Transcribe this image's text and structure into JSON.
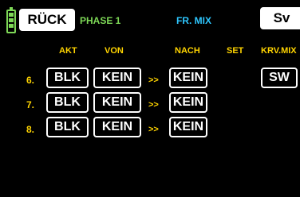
{
  "header": {
    "back_label": "RÜCK",
    "phase_label": "PHASE 1",
    "title": "FR. MIX",
    "sv_label": "Sv"
  },
  "columns": {
    "akt": "AKT",
    "von": "VON",
    "nach": "NACH",
    "set": "SET",
    "krv_mix": "KRV.MIX"
  },
  "rows": [
    {
      "number": "6.",
      "akt": "BLK",
      "von": "KEIN",
      "arrow": ">>",
      "nach": "KEIN"
    },
    {
      "number": "7.",
      "akt": "BLK",
      "von": "KEIN",
      "arrow": ">>",
      "nach": "KEIN"
    },
    {
      "number": "8.",
      "akt": "BLK",
      "von": "KEIN",
      "arrow": ">>",
      "nach": "KEIN"
    }
  ],
  "krv_mix_value": "SW",
  "icons": {
    "battery": "battery-icon"
  },
  "colors": {
    "background": "#000000",
    "green": "#7ed957",
    "cyan": "#2ec7ff",
    "yellow": "#ffd400",
    "white": "#ffffff"
  }
}
